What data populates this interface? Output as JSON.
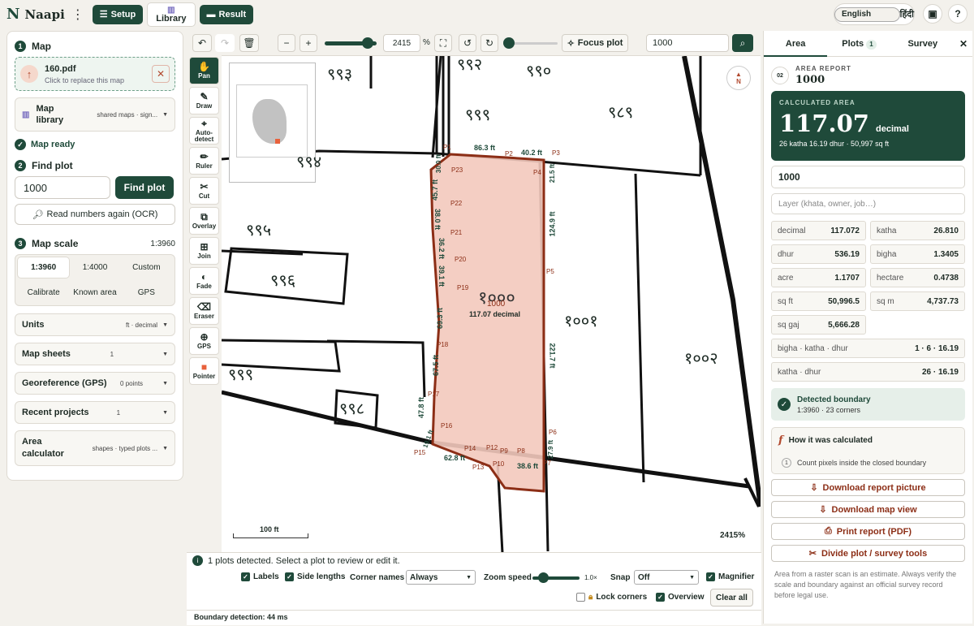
{
  "app": {
    "logo": "N",
    "name": "Naapi"
  },
  "topbar": {
    "setup": "Setup",
    "library": "Library",
    "result": "Result",
    "lang_en": "English",
    "lang_hi": "हिंदी",
    "help": "?"
  },
  "left": {
    "step1": {
      "num": "1",
      "title": "Map"
    },
    "file": {
      "name": "160.pdf",
      "hint": "Click to replace this map"
    },
    "library": {
      "title": "Map library",
      "sub": "shared maps · sign..."
    },
    "ready": "Map ready",
    "step2": {
      "num": "2",
      "title": "Find plot"
    },
    "find_value": "1000",
    "find_btn": "Find plot",
    "ocr": "Read numbers again (OCR)",
    "step3": {
      "num": "3",
      "title": "Map scale",
      "value": "1:3960"
    },
    "scales": [
      "1:3960",
      "1:4000",
      "Custom",
      "Calibrate",
      "Known area",
      "GPS"
    ],
    "sections": [
      {
        "title": "Units",
        "sub": "ft · decimal"
      },
      {
        "title": "Map sheets",
        "sub": "1"
      },
      {
        "title": "Georeference (GPS)",
        "sub": "0 points"
      },
      {
        "title": "Recent projects",
        "sub": "1"
      },
      {
        "title": "Area calculator",
        "sub": "shapes · typed plots ..."
      }
    ]
  },
  "maptoolbar": {
    "zoom": "2415",
    "pct": "%",
    "focus": "Focus plot",
    "search": "1000"
  },
  "tools": [
    {
      "label": "Pan",
      "icon": "✋"
    },
    {
      "label": "Draw",
      "icon": "✎"
    },
    {
      "label": "Auto-detect",
      "icon": "⌖"
    },
    {
      "label": "Ruler",
      "icon": "✏"
    },
    {
      "label": "Cut",
      "icon": "✂"
    },
    {
      "label": "Overlay",
      "icon": "⧉"
    },
    {
      "label": "Join",
      "icon": "⊞"
    },
    {
      "label": "Fade",
      "icon": "◐"
    },
    {
      "label": "Eraser",
      "icon": "⌫"
    },
    {
      "label": "GPS",
      "icon": "⊕"
    },
    {
      "label": "Pointer",
      "icon": "■"
    }
  ],
  "map": {
    "plot_number": "१०००",
    "plot_id": "1000",
    "plot_area": "117.07 decimal",
    "neighbors": [
      "९९३",
      "९९२",
      "९९०",
      "९९९",
      "९८९",
      "९९४",
      "९९५",
      "९९६",
      "१००१",
      "१००२",
      "९९९",
      "९९८"
    ],
    "sides": [
      "86.3 ft",
      "40.2 ft",
      "21.5 ft",
      "124.9 ft",
      "221.7 ft",
      "27.9 ft",
      "38.6 ft",
      "62.8 ft",
      "19.1 ft",
      "47.8 ft",
      "67.5 ft",
      "69.3 ft",
      "39.1 ft",
      "36.2 ft",
      "38.0 ft",
      "45.7 ft",
      "30.0 ft"
    ],
    "corners": [
      "P1",
      "P2",
      "P3",
      "P4",
      "P5",
      "P6",
      "P7",
      "P8",
      "P9",
      "P12",
      "P10",
      "P13",
      "P14",
      "P15",
      "P16",
      "P17",
      "P18",
      "P19",
      "P20",
      "P21",
      "P22",
      "P23"
    ],
    "scalebar": "100 ft",
    "zoom_label": "2415%",
    "north": "N"
  },
  "bottom": {
    "status": "1 plots detected. Select a plot to review or edit it.",
    "labels": "Labels",
    "sides": "Side lengths",
    "corner_names": "Corner names",
    "corner_value": "Always",
    "zoom_speed": "Zoom speed",
    "zoom_speed_value": "1.0×",
    "snap": "Snap",
    "snap_value": "Off",
    "magnifier": "Magnifier",
    "lock": "Lock corners",
    "overview": "Overview",
    "clear": "Clear all",
    "timing": "Boundary detection: 44 ms"
  },
  "right": {
    "tabs": [
      "Area",
      "Plots",
      "Survey"
    ],
    "plots_count": "1",
    "report_badge": "02",
    "report_label": "AREA REPORT",
    "report_id": "1000",
    "calc_label": "CALCULATED AREA",
    "calc_value": "117.07",
    "calc_unit": "decimal",
    "calc_sub": "26 katha 16.19 dhur · 50,997 sq ft",
    "plot_input": "1000",
    "layer_placeholder": "Layer (khata, owner, job…)",
    "units": [
      {
        "label": "decimal",
        "value": "117.072"
      },
      {
        "label": "katha",
        "value": "26.810"
      },
      {
        "label": "dhur",
        "value": "536.19"
      },
      {
        "label": "bigha",
        "value": "1.3405"
      },
      {
        "label": "acre",
        "value": "1.1707"
      },
      {
        "label": "hectare",
        "value": "0.4738"
      },
      {
        "label": "sq ft",
        "value": "50,996.5"
      },
      {
        "label": "sq m",
        "value": "4,737.73"
      },
      {
        "label": "sq gaj",
        "value": "5,666.28"
      }
    ],
    "combo1": {
      "label": "bigha · katha · dhur",
      "value": "1 · 6 · 16.19"
    },
    "combo2": {
      "label": "katha · dhur",
      "value": "26 · 16.19"
    },
    "detected_title": "Detected boundary",
    "detected_sub": "1:3960 · 23 corners",
    "how_title": "How it was calculated",
    "how_step_num": "1",
    "how_step": "Count pixels inside the closed boundary",
    "btn_download_pic": "Download report picture",
    "btn_download_map": "Download map view",
    "btn_print": "Print report (PDF)",
    "btn_divide": "Divide plot / survey tools",
    "note": "Area from a raster scan is an estimate. Always verify the scale and boundary against an official survey record before legal use."
  },
  "colors": {
    "brand": "#1f4a3a",
    "plot_fill": "#f3c9bd",
    "plot_edge": "#8c2e16",
    "accent_red": "#b24a2f"
  }
}
